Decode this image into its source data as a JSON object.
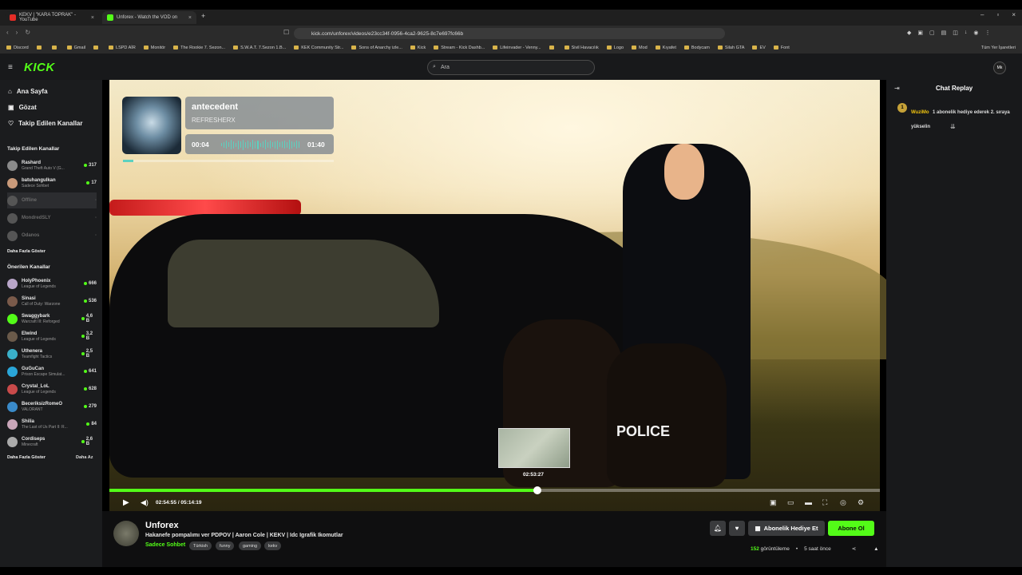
{
  "browser": {
    "tabs": [
      {
        "label": "KEKV | \"KARA TOPRAK\" - YouTube",
        "color": "#e52d27"
      },
      {
        "label": "Unforex - Watch the VOD on",
        "color": "#53fc18"
      }
    ],
    "new_tab": "+",
    "window_controls": [
      "–",
      "▫",
      "×"
    ],
    "url": "kick.com/unforex/videos/e23cc34f-0956-4ca2-9625-8c7e697fc66b",
    "bookmarks": [
      "Discord",
      "",
      "",
      "Gmail",
      "",
      "LSPD AİR",
      "Monitör",
      "The Rookie 7. Sezon...",
      "S.W.A.T. 7.Sezon 1.B...",
      "KEK Community Str...",
      "Sons of Anarchy izle...",
      "Kick",
      "Stream - Kick Dashb...",
      "Lifeinvader - Venny...",
      "",
      "Sivil Havacılık",
      "Logo",
      "Mod",
      "Kıyafet",
      "Bodycam",
      "Silah GTA",
      "EV",
      "Font"
    ],
    "bookmarks_other": "Tüm Yer İşaretleri"
  },
  "site": {
    "logo": "KICK",
    "search_placeholder": "Ara",
    "nav": [
      {
        "icon": "home-icon",
        "label": "Ana Sayfa",
        "glyph": "⌂"
      },
      {
        "icon": "compass-icon",
        "label": "Gözat",
        "glyph": "▣"
      },
      {
        "icon": "heart-icon",
        "label": "Takip Edilen Kanallar",
        "glyph": "♡"
      }
    ],
    "followed_title": "Takip Edilen Kanallar",
    "followed": [
      {
        "name": "Rashard",
        "game": "Grand Theft Auto V (G...",
        "viewers": "317",
        "color": "#8a8a8a"
      },
      {
        "name": "batuhangulkan",
        "game": "Sadece Sohbet",
        "viewers": "17",
        "color": "#c99a7a"
      },
      {
        "name": "Offline",
        "game": "",
        "viewers": "",
        "color": "#555"
      },
      {
        "name": "MondredSLY",
        "game": "",
        "viewers": "",
        "color": "#555"
      },
      {
        "name": "Odanos",
        "game": "",
        "viewers": "",
        "color": "#555"
      }
    ],
    "show_more": "Daha Fazla Göster",
    "recommended_title": "Önerilen Kanallar",
    "recommended": [
      {
        "name": "HolyPhoenix",
        "game": "League of Legends",
        "viewers": "666",
        "color": "#b9a6c9"
      },
      {
        "name": "Sinasi",
        "game": "Call of Duty: Warzone",
        "viewers": "536",
        "color": "#7a5a4a"
      },
      {
        "name": "Swaggybark",
        "game": "Warcraft III: Reforged",
        "viewers": "4,6 B",
        "color": "#53fc18"
      },
      {
        "name": "Elwind",
        "game": "League of Legends",
        "viewers": "3,2 B",
        "color": "#6a5a4a"
      },
      {
        "name": "Uthenera",
        "game": "Teamfight Tactics",
        "viewers": "2,5 B",
        "color": "#3ab0c9"
      },
      {
        "name": "GuGuCan",
        "game": "Prison Escape Simulat...",
        "viewers": "641",
        "color": "#2aa6d9"
      },
      {
        "name": "Crystal_LoL",
        "game": "League of Legends",
        "viewers": "628",
        "color": "#c94a4a"
      },
      {
        "name": "BeceriksizRomeO",
        "game": "VALORANT",
        "viewers": "279",
        "color": "#3a8ac9"
      },
      {
        "name": "Shilia",
        "game": "The Last of Us Part II: R...",
        "viewers": "84",
        "color": "#c9a6b9"
      },
      {
        "name": "Cordiseps",
        "game": "Minecraft",
        "viewers": "2,6 B",
        "color": "#aaa"
      }
    ],
    "show_more_2": "Daha Fazla Göster",
    "hide": "Daha Az"
  },
  "player": {
    "song_title": "antecedent",
    "song_artist": "REFRESHERX",
    "song_time_start": "00:04",
    "song_time_end": "01:40",
    "song_progress": 0.05,
    "overlay_text": "POLICE",
    "preview_time": "02:53:27",
    "current_time": "02:54:55 / 05:14:19",
    "progress": 0.555,
    "controls": [
      "picture-in-picture-icon",
      "theater-icon",
      "minimize-icon",
      "fullscreen-icon",
      "clip-icon",
      "settings-icon"
    ]
  },
  "chat": {
    "title": "Chat Replay",
    "message_user": "WuziMo",
    "message_badge": "1",
    "message_text": "1 abonelik hediye ederek 2. sıraya yükselin",
    "scroll_icon": "⇊"
  },
  "stream": {
    "streamer": "Unforex",
    "title": "Hakanefe pompalımı ver PDPOV | Aaron Cole | KEKV | Idc Igrafik Ikomutlar",
    "category": "Sadece Sohbet",
    "tags": [
      "Türkish",
      "funny",
      "gaming",
      "kekv"
    ],
    "gift_label": "Abonelik Hediye Et",
    "subscribe_label": "Abone Ol",
    "views": "152",
    "views_label": "görüntüleme",
    "time_ago": "5 saat önce"
  }
}
